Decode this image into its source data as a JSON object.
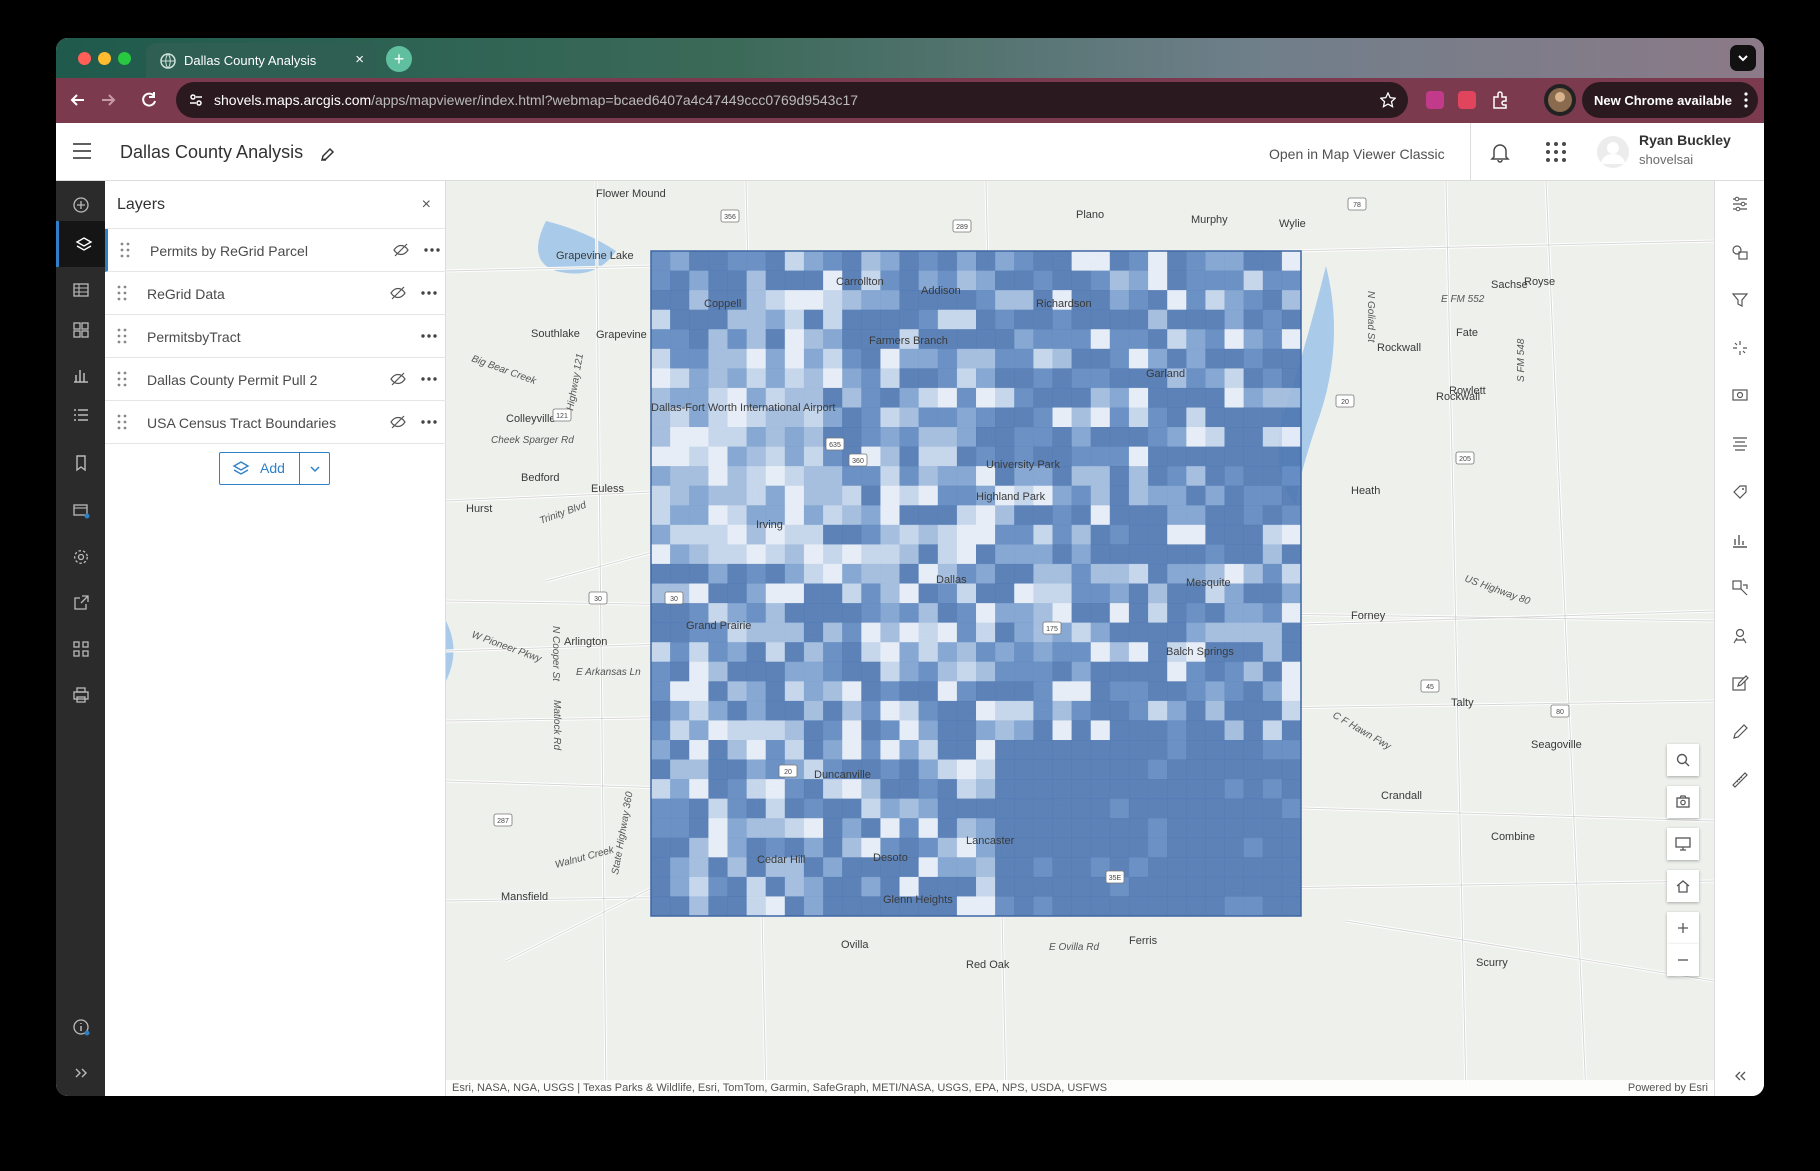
{
  "browser": {
    "tab_title": "Dallas County Analysis",
    "url_host": "shovels.maps.arcgis.com",
    "url_path": "/apps/mapviewer/index.html?webmap=bcaed6407a4c47449ccc0769d9543c17",
    "update_label": "New Chrome available"
  },
  "app": {
    "title": "Dallas County Analysis",
    "open_classic": "Open in Map Viewer Classic",
    "user_name": "Ryan Buckley",
    "user_login": "shovelsai"
  },
  "layers_panel": {
    "title": "Layers",
    "add_label": "Add",
    "layers": [
      {
        "name": "Permits by ReGrid Parcel",
        "hidden": true
      },
      {
        "name": "ReGrid Data",
        "hidden": true
      },
      {
        "name": "PermitsbyTract",
        "hidden": false
      },
      {
        "name": "Dallas County Permit Pull 2",
        "hidden": true
      },
      {
        "name": "USA Census Tract Boundaries",
        "hidden": true
      }
    ]
  },
  "map": {
    "attribution": "Esri, NASA, NGA, USGS | Texas Parks & Wildlife, Esri, TomTom, Garmin, SafeGraph, METI/NASA, USGS, EPA, NPS, USDA, USFWS",
    "powered_by": "Powered by Esri",
    "place_labels": [
      "Flower Mound",
      "Plano",
      "Murphy",
      "Wylie",
      "Royse",
      "Carrollton",
      "Coppell",
      "Richardson",
      "Addison",
      "Sachse",
      "Farmers Branch",
      "Southlake",
      "Grapevine",
      "Grapevine Lake",
      "Rockwall",
      "Rockwall",
      "Fate",
      "Garland",
      "Rowlett",
      "Colleyville",
      "Dallas-Fort Worth International Airport",
      "University Park",
      "Highland Park",
      "Bedford",
      "Euless",
      "Hurst",
      "Irving",
      "Heath",
      "Dallas",
      "Mesquite",
      "Forney",
      "Arlington",
      "Grand Prairie",
      "Balch Springs",
      "Talty",
      "Seagoville",
      "Duncanville",
      "Crandall",
      "Cedar Hill",
      "Desoto",
      "Lancaster",
      "Combine",
      "Mansfield",
      "Glenn Heights",
      "Ovilla",
      "Ferris",
      "Red Oak",
      "Scurry"
    ],
    "highway_shields": [
      "356",
      "289",
      "78",
      "121",
      "635",
      "360",
      "205",
      "30",
      "20",
      "45",
      "287",
      "35E",
      "175",
      "80",
      "30",
      "20"
    ],
    "road_labels": [
      "Trinity Blvd",
      "Cheek Sparger Rd",
      "W Pioneer Pkwy",
      "E Arkansas Ln",
      "Highway 121",
      "N Cooper St",
      "Matlock Rd",
      "State Highway 360",
      "US Highway 80",
      "E FM 552",
      "N Goliad St",
      "S FM 548",
      "C F Hawn Fwy",
      "E Ovilla Rd",
      "Big Bear Creek",
      "Walnut Creek"
    ],
    "choropleth_colors": [
      "#4f78b3",
      "#6189c0",
      "#7da2cf",
      "#9fbbdd",
      "#c3d5ea",
      "#e6edf6"
    ]
  }
}
